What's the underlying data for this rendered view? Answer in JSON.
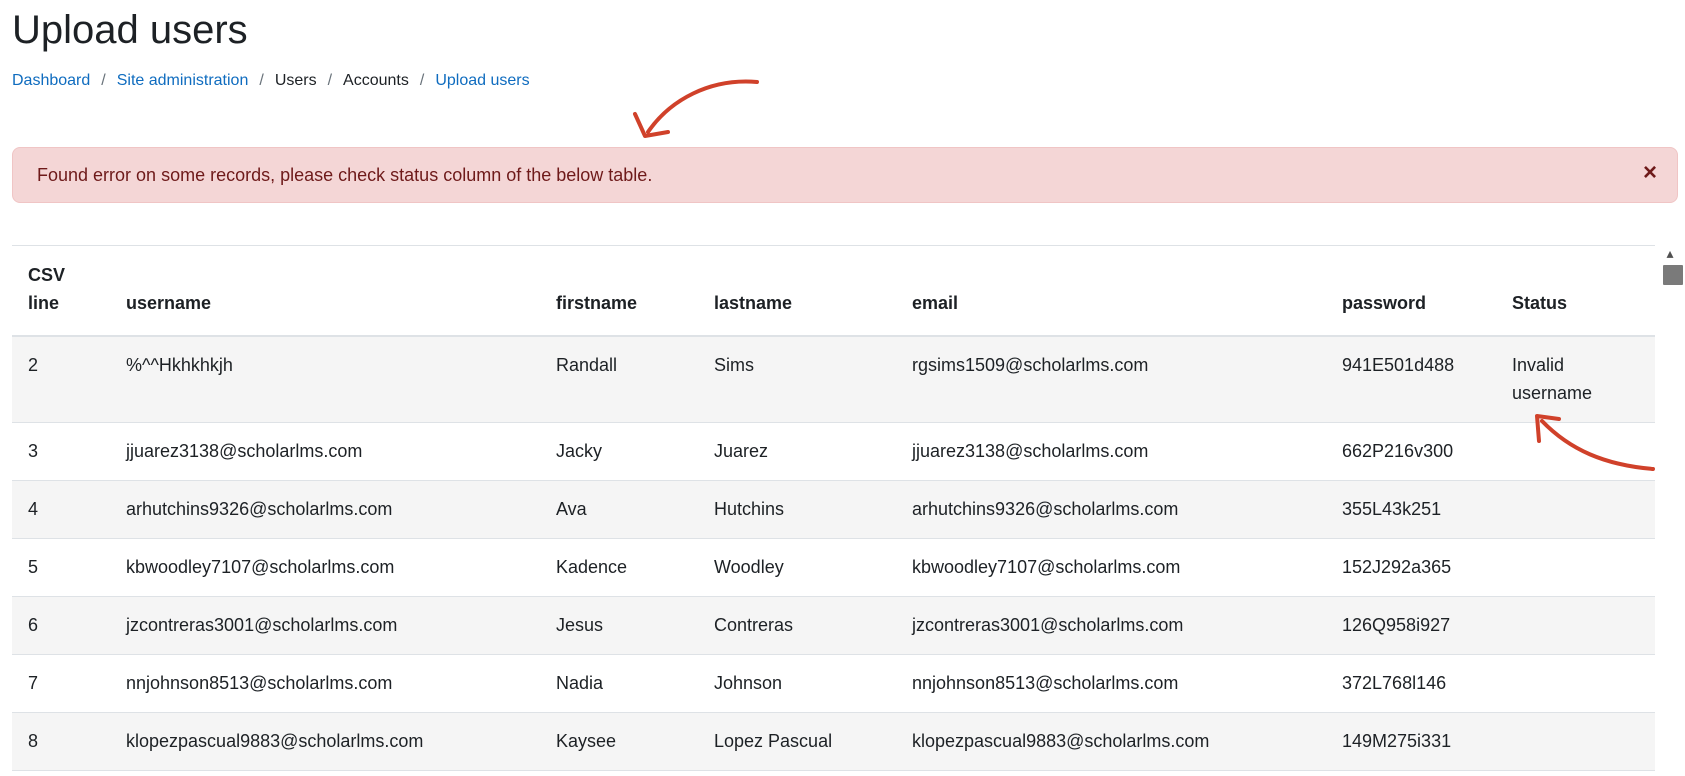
{
  "page": {
    "title": "Upload users"
  },
  "breadcrumb": {
    "items": [
      {
        "label": "Dashboard",
        "link": true
      },
      {
        "label": "Site administration",
        "link": true
      },
      {
        "label": "Users",
        "link": false
      },
      {
        "label": "Accounts",
        "link": false
      },
      {
        "label": "Upload users",
        "link": true
      }
    ],
    "separator": "/"
  },
  "alert": {
    "message": "Found error on some records, please check status column of the below table.",
    "close_symbol": "×"
  },
  "table": {
    "headers": {
      "csv_line": "CSV line",
      "username": "username",
      "firstname": "firstname",
      "lastname": "lastname",
      "email": "email",
      "password": "password",
      "status": "Status"
    },
    "rows": [
      {
        "csv_line": "2",
        "username": "%^^Hkhkhkjh",
        "firstname": "Randall",
        "lastname": "Sims",
        "email": "rgsims1509@scholarlms.com",
        "password": "941E501d488",
        "status": "Invalid username"
      },
      {
        "csv_line": "3",
        "username": "jjuarez3138@scholarlms.com",
        "firstname": "Jacky",
        "lastname": "Juarez",
        "email": "jjuarez3138@scholarlms.com",
        "password": "662P216v300",
        "status": ""
      },
      {
        "csv_line": "4",
        "username": "arhutchins9326@scholarlms.com",
        "firstname": "Ava",
        "lastname": "Hutchins",
        "email": "arhutchins9326@scholarlms.com",
        "password": "355L43k251",
        "status": ""
      },
      {
        "csv_line": "5",
        "username": "kbwoodley7107@scholarlms.com",
        "firstname": "Kadence",
        "lastname": "Woodley",
        "email": "kbwoodley7107@scholarlms.com",
        "password": "152J292a365",
        "status": ""
      },
      {
        "csv_line": "6",
        "username": "jzcontreras3001@scholarlms.com",
        "firstname": "Jesus",
        "lastname": "Contreras",
        "email": "jzcontreras3001@scholarlms.com",
        "password": "126Q958i927",
        "status": ""
      },
      {
        "csv_line": "7",
        "username": "nnjohnson8513@scholarlms.com",
        "firstname": "Nadia",
        "lastname": "Johnson",
        "email": "nnjohnson8513@scholarlms.com",
        "password": "372L768l146",
        "status": ""
      },
      {
        "csv_line": "8",
        "username": "klopezpascual9883@scholarlms.com",
        "firstname": "Kaysee",
        "lastname": "Lopez Pascual",
        "email": "klopezpascual9883@scholarlms.com",
        "password": "149M275i331",
        "status": ""
      }
    ]
  },
  "scrollbar": {
    "up_arrow": "▴"
  },
  "colors": {
    "link": "#0f6cbf",
    "alert_bg": "#f4d6d6",
    "alert_text": "#6e1a1a",
    "annotation_arrow": "#d0412a",
    "stripe": "#f5f5f5"
  }
}
